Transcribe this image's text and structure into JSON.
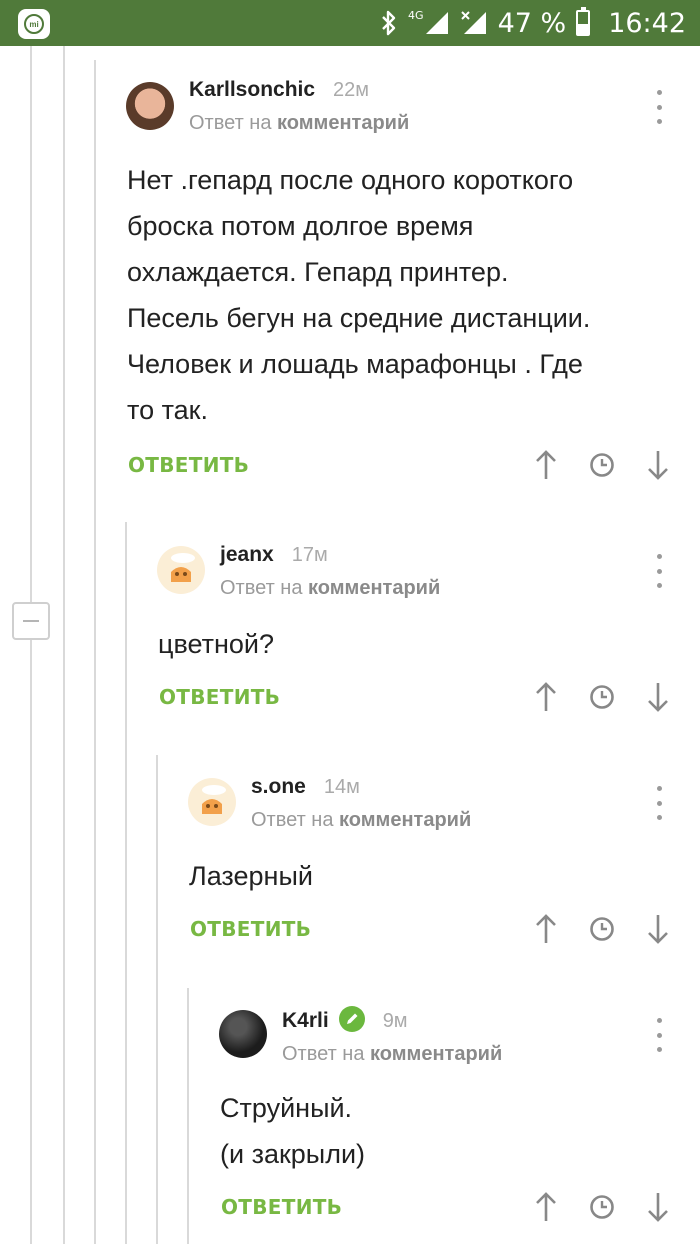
{
  "statusbar": {
    "network": "4G",
    "battery": "47 %",
    "battery_level": 0.47,
    "time": "16:42",
    "launcher_icon": "mi-icon"
  },
  "comments": [
    {
      "author": "Karllsonchic",
      "time": "22м",
      "reply_prefix": "Ответ на",
      "reply_target": "комментарий",
      "lines": [
        "Нет .гепард после одного короткого",
        "броска потом долгое время",
        "охлаждается. Гепард принтер.",
        "Песель бегун на средние дистанции.",
        "Человек и лошадь марафонцы  . Где",
        "то так."
      ],
      "reply_label": "ОТВЕТИТЬ"
    },
    {
      "author": "jeanx",
      "time": "17м",
      "reply_prefix": "Ответ на",
      "reply_target": "комментарий",
      "lines": [
        "цветной?"
      ],
      "reply_label": "ОТВЕТИТЬ"
    },
    {
      "author": "s.one",
      "time": "14м",
      "reply_prefix": "Ответ на",
      "reply_target": "комментарий",
      "lines": [
        "Лазерный"
      ],
      "reply_label": "ОТВЕТИТЬ"
    },
    {
      "author": "K4rli",
      "time": "9м",
      "reply_prefix": "Ответ на",
      "reply_target": "комментарий",
      "lines": [
        "Струйный.",
        "(и закрыли)"
      ],
      "reply_label": "ОТВЕТИТЬ",
      "badge": "pencil-icon"
    }
  ],
  "colors": {
    "statusbar": "#507a3a",
    "accent": "#78b843",
    "badge": "#6bb83e",
    "thread_line": "#d9d9d9"
  }
}
